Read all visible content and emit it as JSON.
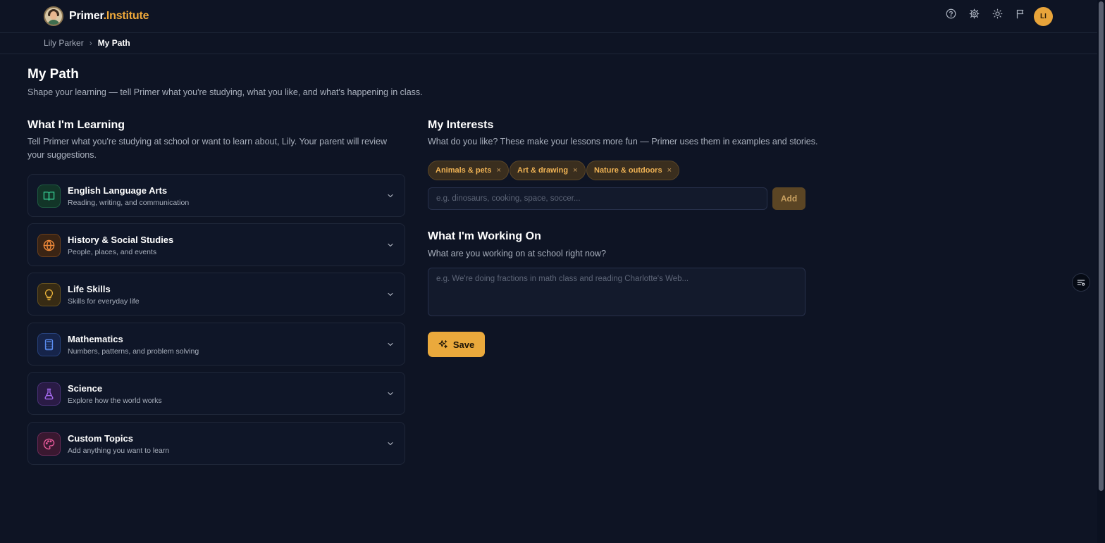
{
  "header": {
    "logo_main": "Primer",
    "logo_accent": ".Institute",
    "user_initials": "LI"
  },
  "breadcrumb": {
    "items": [
      "Lily Parker",
      "My Path"
    ]
  },
  "page": {
    "title": "My Path",
    "subtitle": "Shape your learning — tell Primer what you're studying, what you like, and what's happening in class."
  },
  "learning": {
    "title": "What I'm Learning",
    "subtitle": "Tell Primer what you're studying at school or want to learn about, Lily. Your parent will review your suggestions.",
    "subjects": [
      {
        "name": "English Language Arts",
        "desc": "Reading, writing, and communication",
        "icon": "book-icon",
        "color": "#34c08a"
      },
      {
        "name": "History & Social Studies",
        "desc": "People, places, and events",
        "icon": "globe-icon",
        "color": "#f08a3a"
      },
      {
        "name": "Life Skills",
        "desc": "Skills for everyday life",
        "icon": "lightbulb-icon",
        "color": "#e8b23a"
      },
      {
        "name": "Mathematics",
        "desc": "Numbers, patterns, and problem solving",
        "icon": "calculator-icon",
        "color": "#5a8cf0"
      },
      {
        "name": "Science",
        "desc": "Explore how the world works",
        "icon": "flask-icon",
        "color": "#a66af0"
      },
      {
        "name": "Custom Topics",
        "desc": "Add anything you want to learn",
        "icon": "palette-icon",
        "color": "#e85a9a"
      }
    ]
  },
  "interests": {
    "title": "My Interests",
    "subtitle": "What do you like? These make your lessons more fun — Primer uses them in examples and stories.",
    "chips": [
      "Animals & pets",
      "Art & drawing",
      "Nature & outdoors"
    ],
    "chip_remove": "×",
    "input_placeholder": "e.g. dinosaurs, cooking, space, soccer...",
    "add_label": "Add"
  },
  "working_on": {
    "title": "What I'm Working On",
    "subtitle": "What are you working on at school right now?",
    "placeholder": "e.g. We're doing fractions in math class and reading Charlotte's Web..."
  },
  "save_label": "Save"
}
